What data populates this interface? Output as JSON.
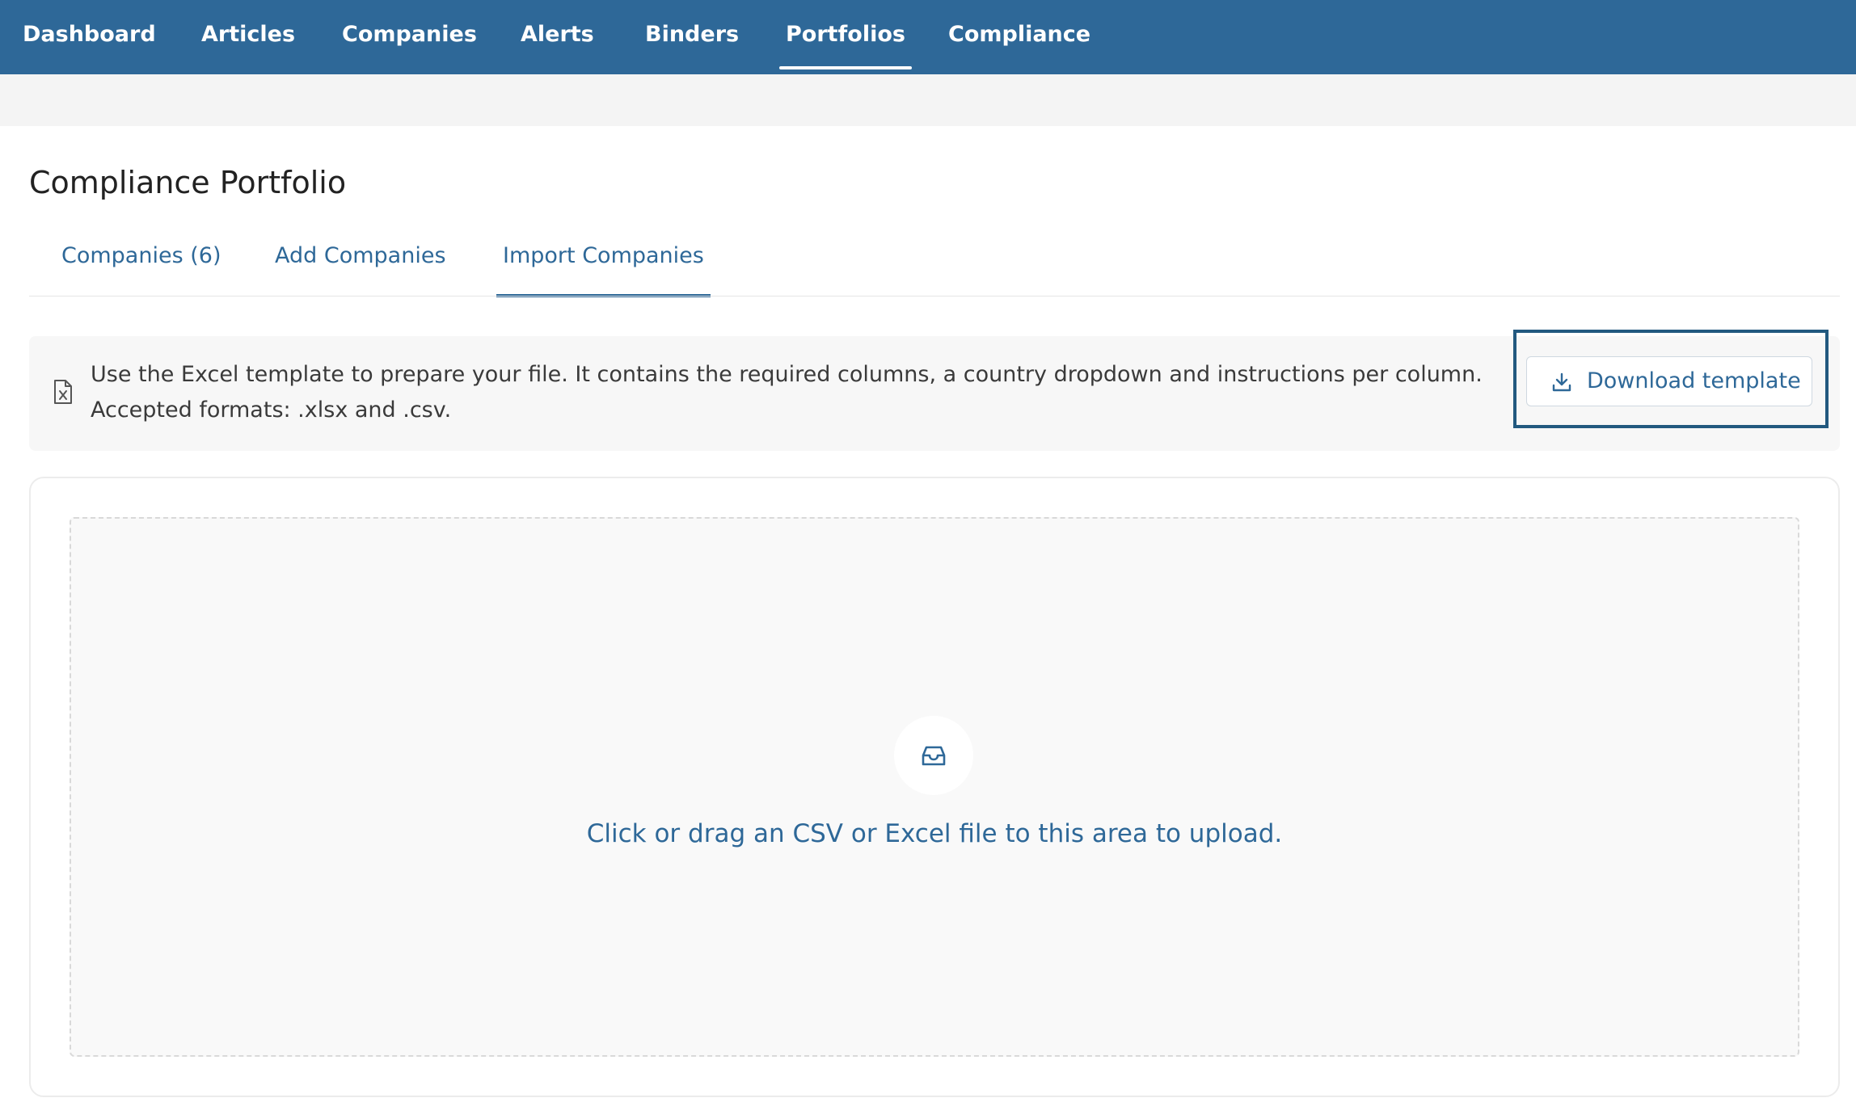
{
  "nav": {
    "items": [
      {
        "label": "Dashboard"
      },
      {
        "label": "Articles"
      },
      {
        "label": "Companies"
      },
      {
        "label": "Alerts"
      },
      {
        "label": "Binders"
      },
      {
        "label": "Portfolios",
        "active": true
      },
      {
        "label": "Compliance"
      }
    ]
  },
  "page": {
    "title": "Compliance Portfolio"
  },
  "tabs": [
    {
      "label": "Companies (6)"
    },
    {
      "label": "Add Companies"
    },
    {
      "label": "Import Companies",
      "active": true
    }
  ],
  "info": {
    "icon": "excel-file-icon",
    "text": "Use the Excel template to prepare your file. It contains the required columns, a country dropdown and instructions per column. Accepted formats: .xlsx and .csv.",
    "download_label": "Download template",
    "download_icon": "download-icon"
  },
  "upload": {
    "icon": "inbox-icon",
    "text": "Click or drag an CSV or Excel file to this area to upload."
  },
  "colors": {
    "nav_bg": "#2e6898",
    "accent": "#2e6898",
    "focus_border": "#22597f"
  }
}
